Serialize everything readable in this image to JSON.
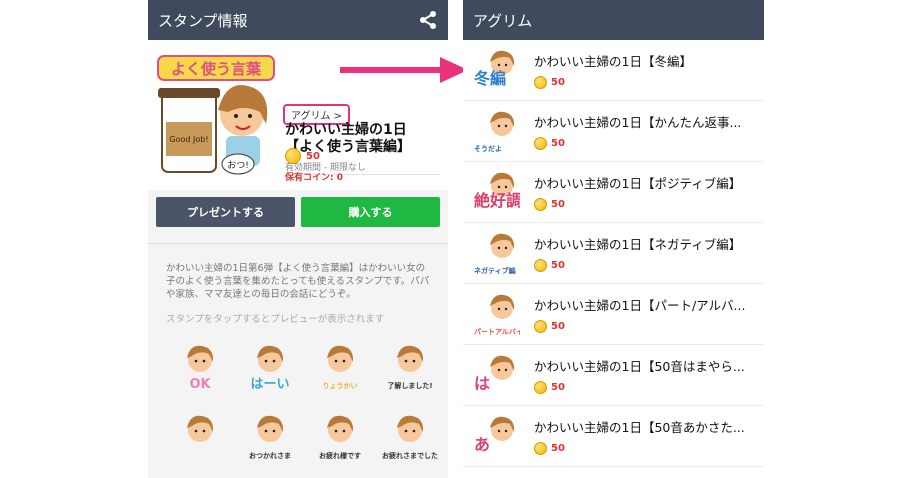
{
  "left": {
    "header_title": "スタンプ情報",
    "author_tag": "アグリム >",
    "title_line1": "かわいい主婦の1日",
    "title_line2": "【よく使う言葉編】",
    "validity": "有効期間 - 期限なし",
    "price": "50",
    "owned_coins_label": "保有コイン: ",
    "owned_coins_value": "0",
    "present_button": "プレゼントする",
    "buy_button": "購入する",
    "description": "かわいい主婦の1日第6弾【よく使う言葉編】はかわいい女の子のよく使う言葉を集めたとっても使えるスタンプです。パパや家族、ママ友達との毎日の会話にどうぞ。",
    "preview_hint": "スタンプをタップするとプレビューが表示されます",
    "main_image_banner": "よく使う言葉",
    "main_image_cup_text": "Good Job!",
    "main_image_bubble": "おつ!",
    "stickers": [
      {
        "text": "OK",
        "color": "#f07fb7"
      },
      {
        "text": "はーい",
        "color": "#3aa7d9"
      },
      {
        "text": "りょうかい",
        "color": "#f0b338"
      },
      {
        "text": "了解しました!",
        "color": "#333333"
      },
      {
        "text": "",
        "color": "#8a5a2b"
      },
      {
        "text": "おつかれさま",
        "color": "#333333"
      },
      {
        "text": "お疲れ様です",
        "color": "#333333"
      },
      {
        "text": "お疲れさまでした",
        "color": "#333333"
      }
    ]
  },
  "right": {
    "header_title": "アグリム",
    "items": [
      {
        "title": "かわいい主婦の1日【冬編】",
        "price": "50",
        "thumb_label": "冬編",
        "thumb_color": "#2f7fcf"
      },
      {
        "title": "かわいい主婦の1日【かんたん返事...",
        "price": "50",
        "thumb_label": "そうだよ",
        "thumb_color": "#1e6fbf"
      },
      {
        "title": "かわいい主婦の1日【ポジティブ編】",
        "price": "50",
        "thumb_label": "絶好調",
        "thumb_color": "#e23b6b"
      },
      {
        "title": "かわいい主婦の1日【ネガティブ編】",
        "price": "50",
        "thumb_label": "ネガティブ編",
        "thumb_color": "#2a5fa8"
      },
      {
        "title": "かわいい主婦の1日【パート/アルバ...",
        "price": "50",
        "thumb_label": "パートアルバイト",
        "thumb_color": "#e84a3c"
      },
      {
        "title": "かわいい主婦の1日【50音はまやら...",
        "price": "50",
        "thumb_label": "は",
        "thumb_color": "#e0407a"
      },
      {
        "title": "かわいい主婦の1日【50音あかさた...",
        "price": "50",
        "thumb_label": "あ",
        "thumb_color": "#e0407a"
      }
    ]
  },
  "colors": {
    "header": "#3f4a5c",
    "buy": "#1fb843",
    "present": "#4b5468",
    "accent": "#e8337b",
    "price": "#dd3333"
  }
}
